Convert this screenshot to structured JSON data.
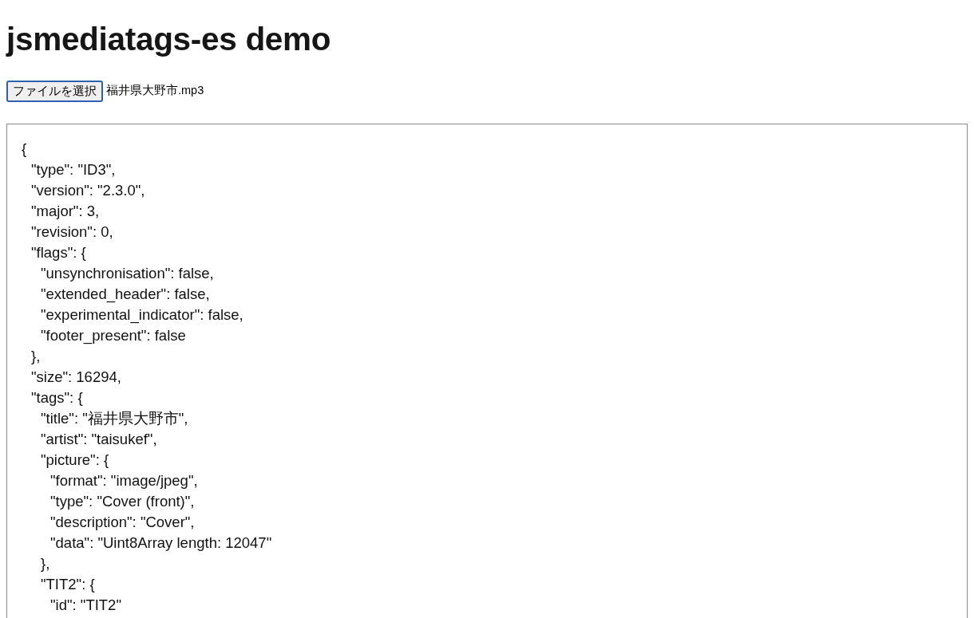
{
  "page": {
    "title": "jsmediatags-es demo"
  },
  "file_input": {
    "button_label": "ファイルを選択",
    "file_name": "福井県大野市.mp3",
    "focused": true
  },
  "output": {
    "lines": [
      {
        "text": "{",
        "children": [
          {
            "text": "\"type\": \"ID3\","
          },
          {
            "text": "\"version\": \"2.3.0\","
          },
          {
            "text": "\"major\": 3,"
          },
          {
            "text": "\"revision\": 0,"
          },
          {
            "text": "\"flags\": {",
            "children": [
              {
                "text": "\"unsynchronisation\": false,"
              },
              {
                "text": "\"extended_header\": false,"
              },
              {
                "text": "\"experimental_indicator\": false,"
              },
              {
                "text": "\"footer_present\": false"
              }
            ]
          },
          {
            "text": "},"
          },
          {
            "text": "\"size\": 16294,"
          },
          {
            "text": "\"tags\": {",
            "children": [
              {
                "text": "\"title\": \"福井県大野市\","
              },
              {
                "text": "\"artist\": \"taisukef\","
              },
              {
                "text": "\"picture\": {",
                "children": [
                  {
                    "text": "\"format\": \"image/jpeg\","
                  },
                  {
                    "text": "\"type\": \"Cover (front)\","
                  },
                  {
                    "text": "\"description\": \"Cover\","
                  },
                  {
                    "text": "\"data\": \"Uint8Array length: 12047\""
                  }
                ]
              },
              {
                "text": "},"
              },
              {
                "text": "\"TIT2\": {",
                "children": [
                  {
                    "text": "\"id\": \"TIT2\""
                  }
                ]
              }
            ]
          }
        ]
      }
    ]
  }
}
